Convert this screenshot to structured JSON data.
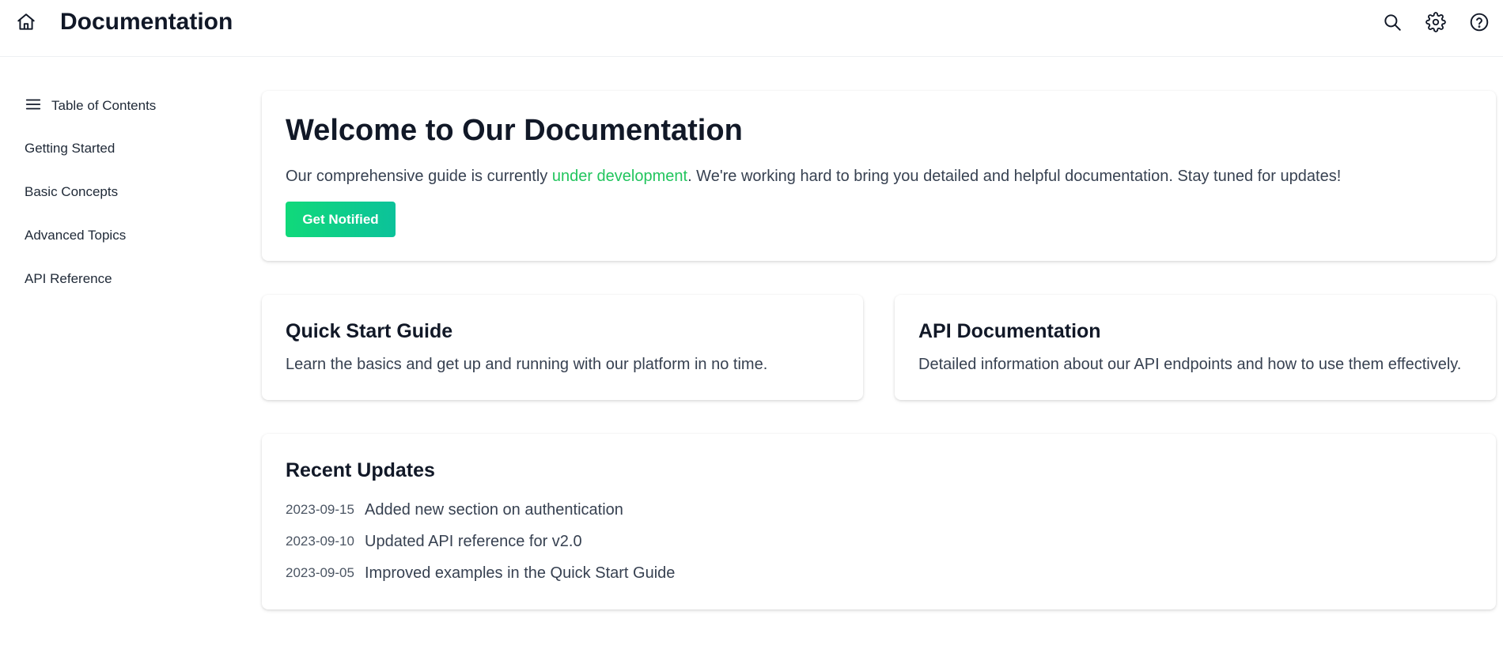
{
  "header": {
    "title": "Documentation",
    "icons": [
      "home-icon",
      "search-icon",
      "gear-icon",
      "help-icon"
    ]
  },
  "sidebar": {
    "toc_label": "Table of Contents",
    "items": [
      {
        "label": "Getting Started"
      },
      {
        "label": "Basic Concepts"
      },
      {
        "label": "Advanced Topics"
      },
      {
        "label": "API Reference"
      }
    ]
  },
  "welcome": {
    "title": "Welcome to Our Documentation",
    "text_before": "Our comprehensive guide is currently ",
    "highlight": "under development",
    "text_after": ". We're working hard to bring you detailed and helpful documentation. Stay tuned for updates!",
    "button_label": "Get Notified"
  },
  "features": [
    {
      "title": "Quick Start Guide",
      "description": "Learn the basics and get up and running with our platform in no time."
    },
    {
      "title": "API Documentation",
      "description": "Detailed information about our API endpoints and how to use them effectively."
    }
  ],
  "updates": {
    "title": "Recent Updates",
    "items": [
      {
        "date": "2023-09-15",
        "text": "Added new section on authentication"
      },
      {
        "date": "2023-09-10",
        "text": "Updated API reference for v2.0"
      },
      {
        "date": "2023-09-05",
        "text": "Improved examples in the Quick Start Guide"
      }
    ]
  },
  "colors": {
    "accent": "#22c55e",
    "button_gradient_start": "#10d97a",
    "button_gradient_end": "#0cc29a",
    "heading": "#111827",
    "body_text": "#374151"
  }
}
